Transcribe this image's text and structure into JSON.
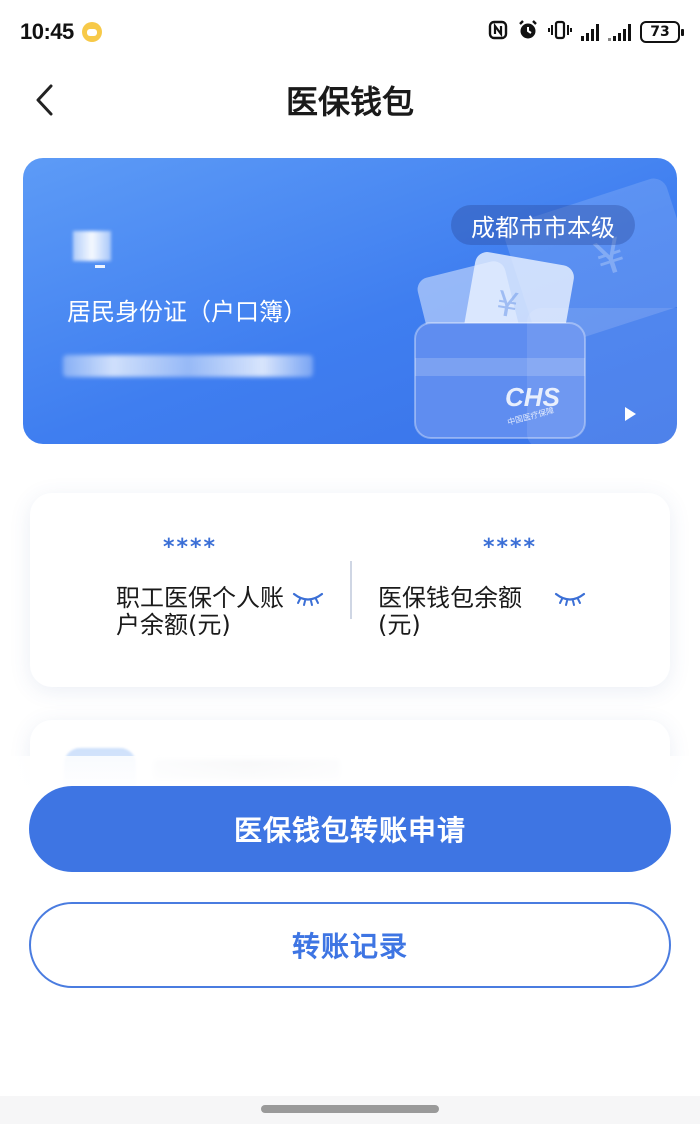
{
  "status_bar": {
    "time": "10:45",
    "battery": "73",
    "icons": [
      "nfc-icon",
      "alarm-icon",
      "vibrate-icon",
      "signal-icon",
      "signal-icon",
      "battery-icon"
    ]
  },
  "nav": {
    "title": "医保钱包",
    "back_icon": "chevron-left-icon"
  },
  "card": {
    "region": "成都市市本级",
    "id_type": "居民身份证（户口簿）",
    "emblem_text": "CHS",
    "emblem_subtext": "中国医疗保障",
    "play_icon": "play-icon",
    "colors": {
      "gradient_start": "#5d9bf6",
      "gradient_end": "#3a73e8"
    }
  },
  "balances": [
    {
      "value": "****",
      "label": "职工医保个人账户余额(元)",
      "toggle_icon": "eye-closed-icon"
    },
    {
      "value": "****",
      "label": "医保钱包余额(元)",
      "toggle_icon": "eye-closed-icon"
    }
  ],
  "actions": {
    "primary_label": "医保钱包转账申请",
    "secondary_label": "转账记录"
  },
  "colors": {
    "accent": "#3e75e3",
    "masked_value": "#3b6fd6"
  }
}
